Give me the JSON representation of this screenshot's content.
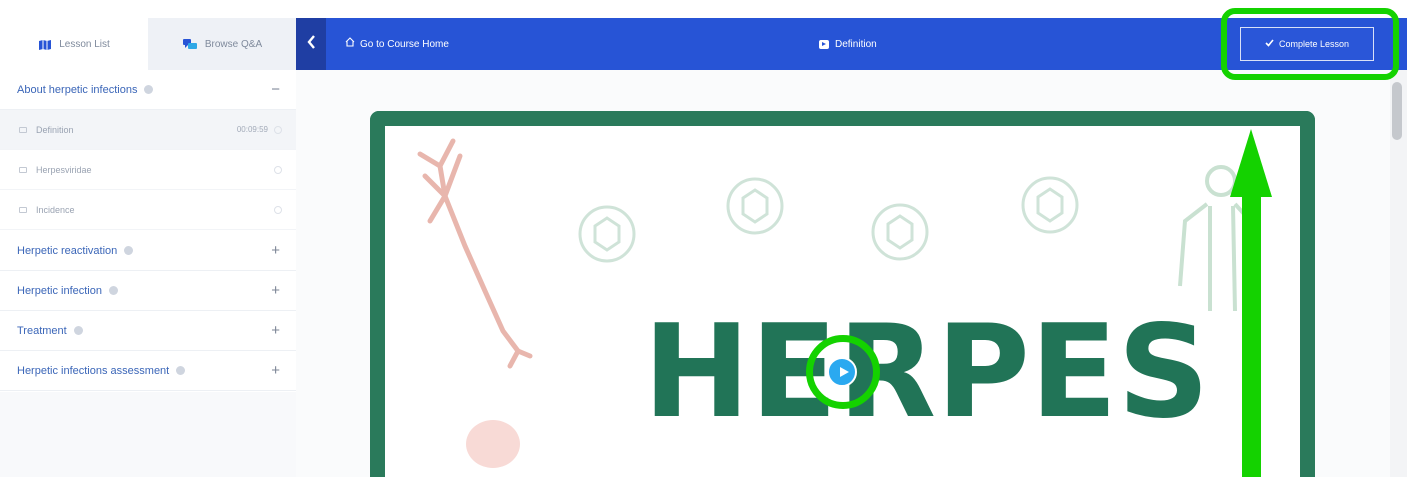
{
  "colors": {
    "topbar": "#2754d6",
    "accent_link": "#3b66b8",
    "highlight": "#14d200",
    "frame": "#2a7a5b"
  },
  "sidebar": {
    "tabs": [
      {
        "label": "Lesson List",
        "icon": "book-map-icon",
        "active": true
      },
      {
        "label": "Browse Q&A",
        "icon": "qa-icon",
        "active": false
      }
    ],
    "sections": [
      {
        "label": "About herpetic infections",
        "toggle": "−",
        "lessons": [
          {
            "label": "Definition",
            "time": "00:09:59"
          },
          {
            "label": "Herpesviridae",
            "time": ""
          },
          {
            "label": "Incidence",
            "time": ""
          }
        ]
      },
      {
        "label": "Herpetic reactivation",
        "toggle": "+"
      },
      {
        "label": "Herpetic infection",
        "toggle": "+"
      },
      {
        "label": "Treatment",
        "toggle": "+"
      },
      {
        "label": "Herpetic infections assessment",
        "toggle": "+"
      }
    ]
  },
  "topbar": {
    "home_label": "Go to Course Home",
    "lesson_title": "Definition",
    "complete_label": "Complete Lesson"
  },
  "video": {
    "title_text": "HERPES"
  }
}
